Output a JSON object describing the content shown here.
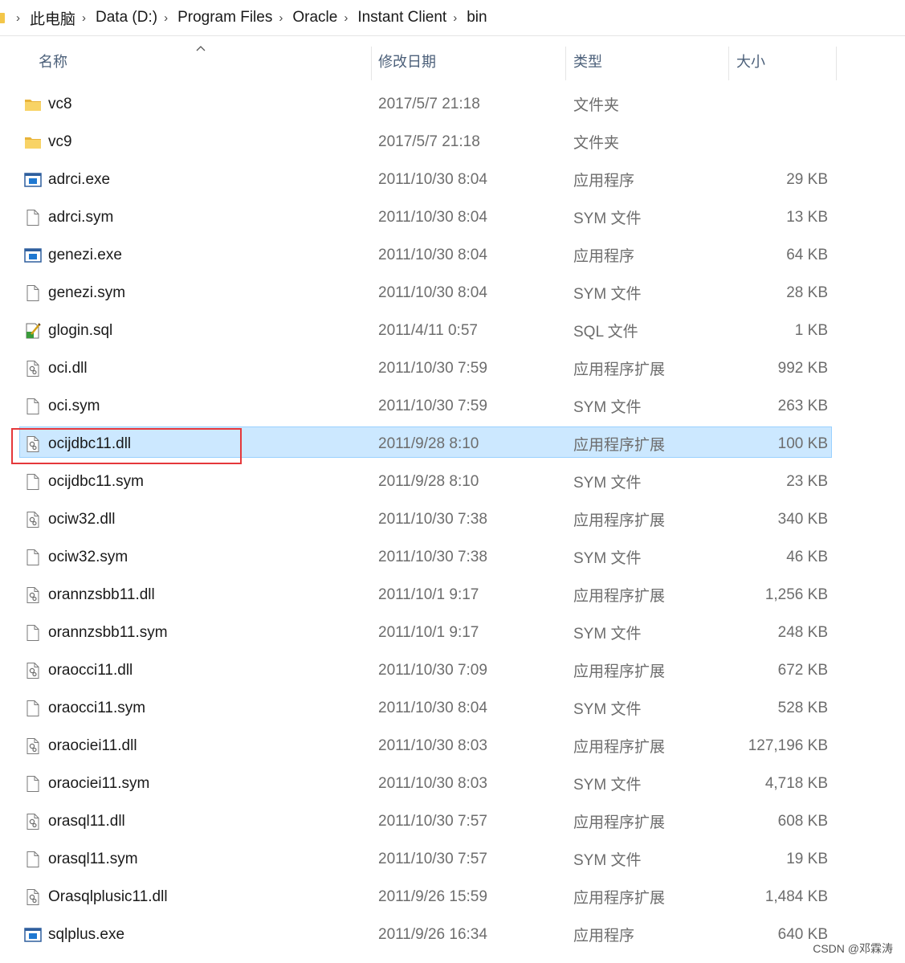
{
  "breadcrumb": [
    "此电脑",
    "Data (D:)",
    "Program Files",
    "Oracle",
    "Instant Client",
    "bin"
  ],
  "columns": {
    "name": "名称",
    "date": "修改日期",
    "type": "类型",
    "size": "大小"
  },
  "files": [
    {
      "icon": "folder-icon",
      "name": "vc8",
      "date": "2017/5/7 21:18",
      "type": "文件夹",
      "size": ""
    },
    {
      "icon": "folder-icon",
      "name": "vc9",
      "date": "2017/5/7 21:18",
      "type": "文件夹",
      "size": ""
    },
    {
      "icon": "exe-icon",
      "name": "adrci.exe",
      "date": "2011/10/30 8:04",
      "type": "应用程序",
      "size": "29 KB"
    },
    {
      "icon": "file-icon",
      "name": "adrci.sym",
      "date": "2011/10/30 8:04",
      "type": "SYM 文件",
      "size": "13 KB"
    },
    {
      "icon": "exe-icon",
      "name": "genezi.exe",
      "date": "2011/10/30 8:04",
      "type": "应用程序",
      "size": "64 KB"
    },
    {
      "icon": "file-icon",
      "name": "genezi.sym",
      "date": "2011/10/30 8:04",
      "type": "SYM 文件",
      "size": "28 KB"
    },
    {
      "icon": "sql-icon",
      "name": "glogin.sql",
      "date": "2011/4/11 0:57",
      "type": "SQL 文件",
      "size": "1 KB"
    },
    {
      "icon": "dll-icon",
      "name": "oci.dll",
      "date": "2011/10/30 7:59",
      "type": "应用程序扩展",
      "size": "992 KB"
    },
    {
      "icon": "file-icon",
      "name": "oci.sym",
      "date": "2011/10/30 7:59",
      "type": "SYM 文件",
      "size": "263 KB"
    },
    {
      "icon": "dll-icon",
      "name": "ocijdbc11.dll",
      "date": "2011/9/28 8:10",
      "type": "应用程序扩展",
      "size": "100 KB",
      "selected": true
    },
    {
      "icon": "file-icon",
      "name": "ocijdbc11.sym",
      "date": "2011/9/28 8:10",
      "type": "SYM 文件",
      "size": "23 KB"
    },
    {
      "icon": "dll-icon",
      "name": "ociw32.dll",
      "date": "2011/10/30 7:38",
      "type": "应用程序扩展",
      "size": "340 KB"
    },
    {
      "icon": "file-icon",
      "name": "ociw32.sym",
      "date": "2011/10/30 7:38",
      "type": "SYM 文件",
      "size": "46 KB"
    },
    {
      "icon": "dll-icon",
      "name": "orannzsbb11.dll",
      "date": "2011/10/1 9:17",
      "type": "应用程序扩展",
      "size": "1,256 KB"
    },
    {
      "icon": "file-icon",
      "name": "orannzsbb11.sym",
      "date": "2011/10/1 9:17",
      "type": "SYM 文件",
      "size": "248 KB"
    },
    {
      "icon": "dll-icon",
      "name": "oraocci11.dll",
      "date": "2011/10/30 7:09",
      "type": "应用程序扩展",
      "size": "672 KB"
    },
    {
      "icon": "file-icon",
      "name": "oraocci11.sym",
      "date": "2011/10/30 8:04",
      "type": "SYM 文件",
      "size": "528 KB"
    },
    {
      "icon": "dll-icon",
      "name": "oraociei11.dll",
      "date": "2011/10/30 8:03",
      "type": "应用程序扩展",
      "size": "127,196 KB"
    },
    {
      "icon": "file-icon",
      "name": "oraociei11.sym",
      "date": "2011/10/30 8:03",
      "type": "SYM 文件",
      "size": "4,718 KB"
    },
    {
      "icon": "dll-icon",
      "name": "orasql11.dll",
      "date": "2011/10/30 7:57",
      "type": "应用程序扩展",
      "size": "608 KB"
    },
    {
      "icon": "file-icon",
      "name": "orasql11.sym",
      "date": "2011/10/30 7:57",
      "type": "SYM 文件",
      "size": "19 KB"
    },
    {
      "icon": "dll-icon",
      "name": "Orasqlplusic11.dll",
      "date": "2011/9/26 15:59",
      "type": "应用程序扩展",
      "size": "1,484 KB"
    },
    {
      "icon": "exe-icon",
      "name": "sqlplus.exe",
      "date": "2011/9/26 16:34",
      "type": "应用程序",
      "size": "640 KB"
    }
  ],
  "watermark": "CSDN @邓霖涛",
  "colors": {
    "selection": "#cce8ff",
    "annotation_box": "#e5383b",
    "folder": "#f3c649"
  }
}
